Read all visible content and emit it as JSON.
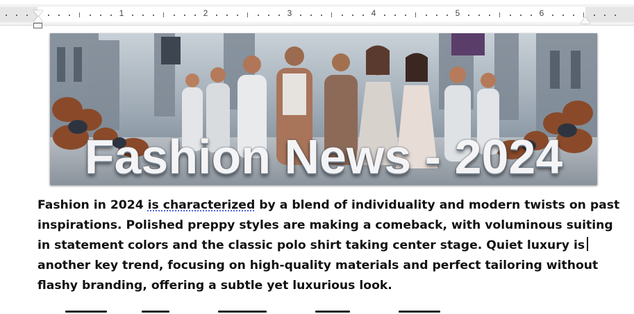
{
  "ruler": {
    "numbers": [
      "1",
      "2",
      "3",
      "4",
      "5",
      "6"
    ]
  },
  "banner": {
    "title": "Fashion News - 2024"
  },
  "document": {
    "paragraph": {
      "line1_plain_start": "Fashion in 2024 ",
      "line1_flagged": "is characterized",
      "line1_plain_end": " by a blend of individuality and modern twists on past",
      "line2": "inspirations. Polished preppy styles are making a comeback, with voluminous suiting",
      "line3": "in statement colors and the classic polo shirt taking center stage. Quiet luxury is",
      "line4": "another key trend, focusing on high-quality materials and perfect tailoring without",
      "line5": "flashy branding, offering a subtle yet luxurious look."
    }
  },
  "colors": {
    "grammar_flag": "#3a4bd8",
    "text": "#111111",
    "ruler_bg": "#f3f3f3"
  }
}
